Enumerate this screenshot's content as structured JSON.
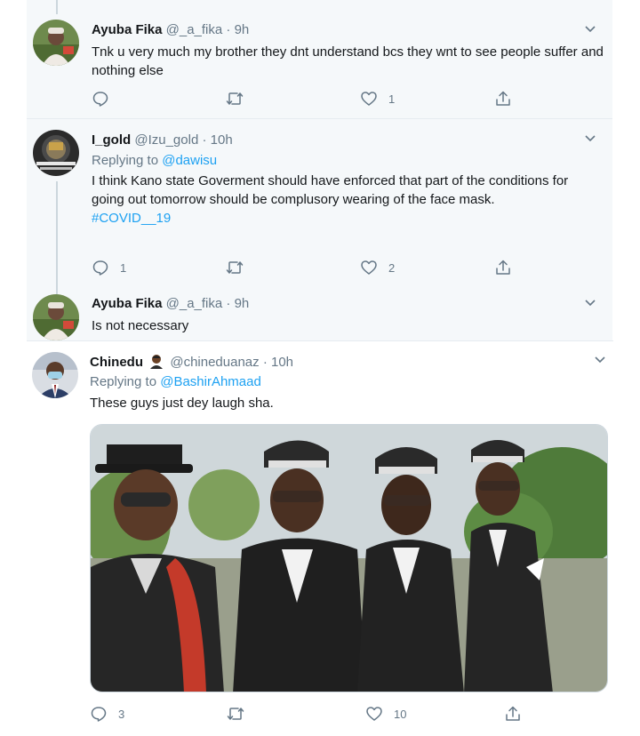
{
  "tweets": [
    {
      "display_name": "Ayuba Fika",
      "handle": "@_a_fika",
      "sep": "·",
      "time": "9h",
      "text": "Tnk u very much my brother they dnt understand bcs they wnt to see people suffer and nothing else",
      "actions": {
        "reply": "",
        "retweet": "",
        "like": "1",
        "share": ""
      }
    },
    {
      "display_name": "I_gold",
      "handle": "@Izu_gold",
      "sep": "·",
      "time": "10h",
      "replying_prefix": "Replying to",
      "replying_to": "@dawisu",
      "text": "I think Kano state Goverment should have enforced that part of the conditions for going out tomorrow should be complusory wearing of the face mask.",
      "hashtag": "#COVID__19",
      "actions": {
        "reply": "1",
        "retweet": "",
        "like": "2",
        "share": ""
      }
    },
    {
      "display_name": "Ayuba Fika",
      "handle": "@_a_fika",
      "sep": "·",
      "time": "9h",
      "text": "Is not necessary"
    },
    {
      "display_name": "Chinedu",
      "handle": "@chineduanaz",
      "sep": "·",
      "time": "10h",
      "replying_prefix": "Replying to",
      "replying_to": "@BashirAhmaad",
      "text": "These guys just dey laugh sha.",
      "actions": {
        "reply": "3",
        "retweet": "",
        "like": "10",
        "share": ""
      }
    }
  ],
  "colors": {
    "accent": "#1da1f2",
    "secondary_text": "#657786",
    "panel_bg": "#f5f8fa",
    "thread_line": "#ccd6dd"
  },
  "icons": [
    "reply-icon",
    "retweet-icon",
    "like-icon",
    "share-icon",
    "chevron-down-icon",
    "man-emoji-icon"
  ]
}
